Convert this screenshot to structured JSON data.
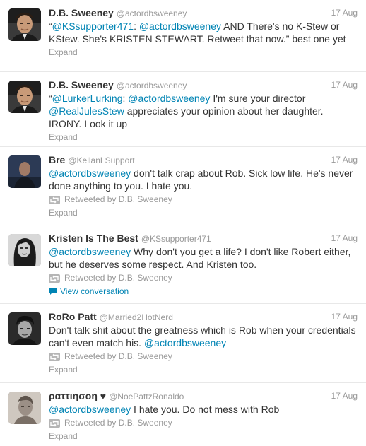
{
  "colors": {
    "link": "#0084b4",
    "muted": "#999999",
    "text": "#333333",
    "divider": "#e8e8e8"
  },
  "tweets": [
    {
      "fullname": "D.B. Sweeney",
      "username": "@actordbsweeney",
      "time": "17 Aug",
      "parts": [
        {
          "text": "“",
          "link": false
        },
        {
          "text": "@KSsupporter471",
          "link": true
        },
        {
          "text": ": ",
          "link": false
        },
        {
          "text": "@actordbsweeney",
          "link": true
        },
        {
          "text": " AND There's no K-Stew or KStew. She's KRISTEN STEWART. Retweet that now.” best one yet",
          "link": false
        }
      ],
      "retweeted_by": "",
      "view_conversation": "",
      "expand": "Expand",
      "avatar": "man-headshot-icon"
    },
    {
      "fullname": "D.B. Sweeney",
      "username": "@actordbsweeney",
      "time": "17 Aug",
      "parts": [
        {
          "text": "“",
          "link": false
        },
        {
          "text": "@LurkerLurking",
          "link": true
        },
        {
          "text": ": ",
          "link": false
        },
        {
          "text": "@actordbsweeney",
          "link": true
        },
        {
          "text": " I'm sure your director ",
          "link": false
        },
        {
          "text": "@RealJulesStew",
          "link": true
        },
        {
          "text": " appreciates your opinion about her daughter. IRONY. Look it up",
          "link": false
        }
      ],
      "retweeted_by": "",
      "view_conversation": "",
      "expand": "Expand",
      "avatar": "man-headshot-icon"
    },
    {
      "fullname": "Bre",
      "username": "@KellanLSupport",
      "time": "17 Aug",
      "parts": [
        {
          "text": "@actordbsweeney",
          "link": true
        },
        {
          "text": " don't talk crap about Rob. Sick low life. He's never done anything to you. I hate you.",
          "link": false
        }
      ],
      "retweeted_by": "Retweeted by D.B. Sweeney",
      "view_conversation": "",
      "expand": "Expand",
      "avatar": "man-dark-photo-icon"
    },
    {
      "fullname": "Kristen Is The Best",
      "username": "@KSsupporter471",
      "time": "17 Aug",
      "parts": [
        {
          "text": "@actordbsweeney",
          "link": true
        },
        {
          "text": " Why don't you get a life? I don't like Robert either, but he deserves some respect. And Kristen too.",
          "link": false
        }
      ],
      "retweeted_by": "Retweeted by D.B. Sweeney",
      "view_conversation": "View conversation",
      "expand": "",
      "avatar": "woman-bw-photo-icon"
    },
    {
      "fullname": "RoRo Patt",
      "username": "@Married2HotNerd",
      "time": "17 Aug",
      "parts": [
        {
          "text": "Don't talk shit about the greatness which is Rob when your credentials can't even match his. ",
          "link": false
        },
        {
          "text": "@actordbsweeney",
          "link": true
        }
      ],
      "retweeted_by": "Retweeted by D.B. Sweeney",
      "view_conversation": "",
      "expand": "Expand",
      "avatar": "man-bw-photo-icon"
    },
    {
      "fullname": "ραττιησοη ♥",
      "username": "@NoePattzRonaldo",
      "time": "17 Aug",
      "parts": [
        {
          "text": "@actordbsweeney",
          "link": true
        },
        {
          "text": " I hate you. Do not mess with Rob",
          "link": false
        }
      ],
      "retweeted_by": "Retweeted by D.B. Sweeney",
      "view_conversation": "",
      "expand": "Expand",
      "avatar": "man-sepia-photo-icon"
    }
  ]
}
